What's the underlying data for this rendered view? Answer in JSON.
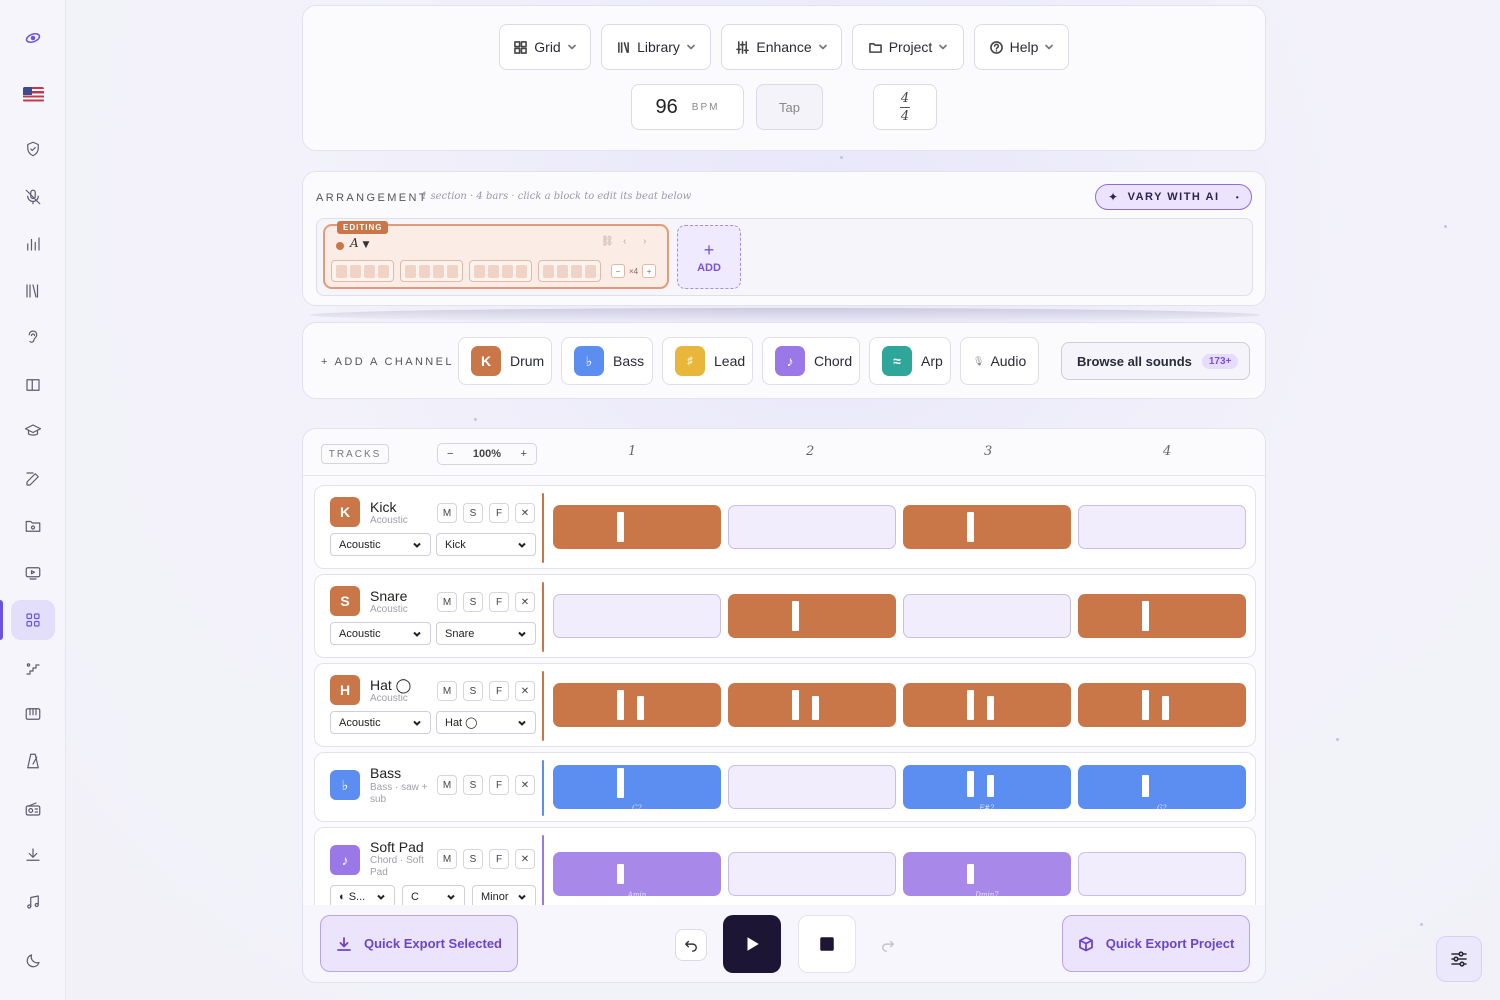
{
  "toolbar": {
    "menus": [
      {
        "label": "Grid",
        "icon": "grid-icon"
      },
      {
        "label": "Library",
        "icon": "library-icon"
      },
      {
        "label": "Enhance",
        "icon": "sliders-icon"
      },
      {
        "label": "Project",
        "icon": "folder-icon"
      },
      {
        "label": "Help",
        "icon": "help-icon"
      }
    ],
    "bpm_value": "96",
    "bpm_unit": "BPM",
    "tap_label": "Tap",
    "time_sig_top": "4",
    "time_sig_bottom": "4"
  },
  "arrangement": {
    "label": "ARRANGEMENT",
    "hint": "1 section · 4 bars · click a block to edit its beat below",
    "vary_label": "VARY WITH AI",
    "section": {
      "badge": "EDITING",
      "name": "A",
      "repeat": "×4",
      "minus": "−",
      "plus": "+"
    },
    "add_label": "ADD",
    "add_symbol": "+"
  },
  "channels": {
    "label": "+ ADD A CHANNEL",
    "items": [
      {
        "label": "Drum",
        "glyph": "K",
        "color": "#c97749"
      },
      {
        "label": "Bass",
        "glyph": "♭",
        "color": "#5b8ef0"
      },
      {
        "label": "Lead",
        "glyph": "♯",
        "color": "#e8b63a"
      },
      {
        "label": "Chord",
        "glyph": "♪",
        "color": "#9a78e8"
      },
      {
        "label": "Arp",
        "glyph": "≈",
        "color": "#2fa69a"
      },
      {
        "label": "Audio",
        "glyph": "🎙",
        "color": "#ffffff"
      }
    ],
    "browse_label": "Browse all sounds",
    "browse_count": "173+"
  },
  "tracks": {
    "label": "TRACKS",
    "zoom": "100%",
    "zoom_minus": "−",
    "zoom_plus": "+",
    "bar_numbers": [
      "1",
      "2",
      "3",
      "4"
    ],
    "mute": "M",
    "solo": "S",
    "fx": "F",
    "remove": "✕",
    "rows": [
      {
        "name": "Kick",
        "sub": "Acoustic",
        "glyph": "K",
        "select1": "Acoustic",
        "select2": "Kick"
      },
      {
        "name": "Snare",
        "sub": "Acoustic",
        "glyph": "S",
        "select1": "Acoustic",
        "select2": "Snare"
      },
      {
        "name": "Hat ◯",
        "sub": "Acoustic",
        "glyph": "H",
        "select1": "Acoustic",
        "select2": "Hat ◯"
      },
      {
        "name": "Bass",
        "sub": "Bass · saw + sub",
        "glyph": "♭"
      },
      {
        "name": "Soft Pad",
        "sub": "Chord · Soft Pad",
        "glyph": "♪",
        "select1": "◐ S...",
        "select2": "C",
        "select3": "Minor"
      }
    ],
    "bass_notes": [
      "C2",
      "",
      "F#2",
      "G2"
    ],
    "pad_chords": [
      "Amin",
      "",
      "Dmin7",
      ""
    ]
  },
  "colors": {
    "drum": "#c97749",
    "bass": "#5b8ef0",
    "chord": "#a889ea",
    "accent": "#6b55e0"
  },
  "footer": {
    "export_selected": "Quick Export Selected",
    "export_project": "Quick Export Project"
  }
}
